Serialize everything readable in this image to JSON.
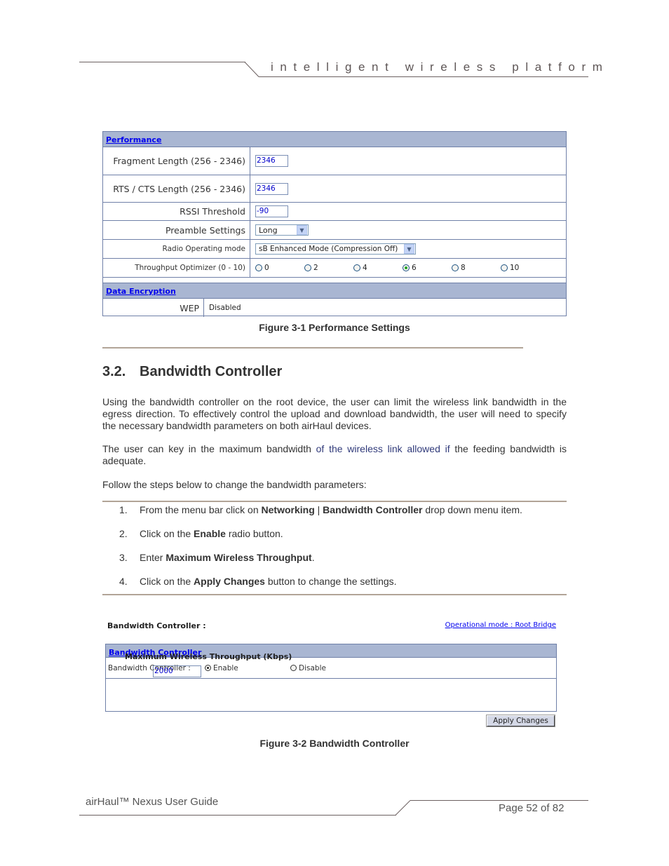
{
  "header": {
    "tagline": "intelligent wireless platform"
  },
  "figure1": {
    "section_performance": "Performance",
    "rows": [
      {
        "label": "Fragment Length (256 - 2346)",
        "value": "2346"
      },
      {
        "label": "RTS / CTS Length (256 - 2346)",
        "value": "2346"
      },
      {
        "label": "RSSI Threshold",
        "value": "-90"
      }
    ],
    "preamble": {
      "label": "Preamble Settings",
      "selected": "Long"
    },
    "radio_mode": {
      "label": "Radio Operating mode",
      "selected": "sB Enhanced Mode (Compression Off)"
    },
    "throughput": {
      "label": "Throughput Optimizer (0 - 10)",
      "options": [
        "0",
        "2",
        "4",
        "6",
        "8",
        "10"
      ],
      "selected": "6"
    },
    "section_encryption": "Data Encryption",
    "wep": {
      "label": "WEP",
      "value": "Disabled"
    },
    "caption": "Figure 3-1 Performance Settings"
  },
  "section": {
    "number": "3.2.",
    "title": "Bandwidth Controller",
    "para1": "Using the bandwidth controller on the root device, the user can limit the wireless link bandwidth in the egress direction. To effectively control the upload and download bandwidth, the user will need to specify the necessary bandwidth parameters on both airHaul devices.",
    "para2_a": "The user can key in the maximum bandwidth ",
    "para2_b": "of the wireless link allowed if",
    "para2_c": " the feeding bandwidth is adequate.",
    "para3": "Follow the steps below to change the bandwidth parameters:"
  },
  "steps": [
    {
      "n": "1.",
      "a": "From the menu bar click on ",
      "b1": "Networking",
      "sep": " | ",
      "b2": "Bandwidth Controller",
      "c": " drop down menu item."
    },
    {
      "n": "2.",
      "a": "Click on the ",
      "b1": "Enable",
      "c": " radio button."
    },
    {
      "n": "3.",
      "a": "Enter ",
      "b1": "Maximum Wireless Throughput",
      "c": "."
    },
    {
      "n": "4.",
      "a": "Click on the ",
      "b1": "Apply Changes",
      "c": " button to change the settings."
    }
  ],
  "figure2": {
    "title": "Bandwidth Controller :",
    "operational_mode": "Operational mode : Root Bridge",
    "section": "Bandwidth Controller",
    "bc_label": "Bandwidth Controller :",
    "enable": "Enable",
    "disable": "Disable",
    "selected": "Enable",
    "mwt_label": "Maximum Wireless Throughput (Kbps)",
    "mwt_value": "2000",
    "apply": "Apply Changes",
    "caption": "Figure 3-2 Bandwidth Controller"
  },
  "footer": {
    "title": "airHaul™ Nexus User Guide",
    "page": "Page 52 of 82"
  }
}
